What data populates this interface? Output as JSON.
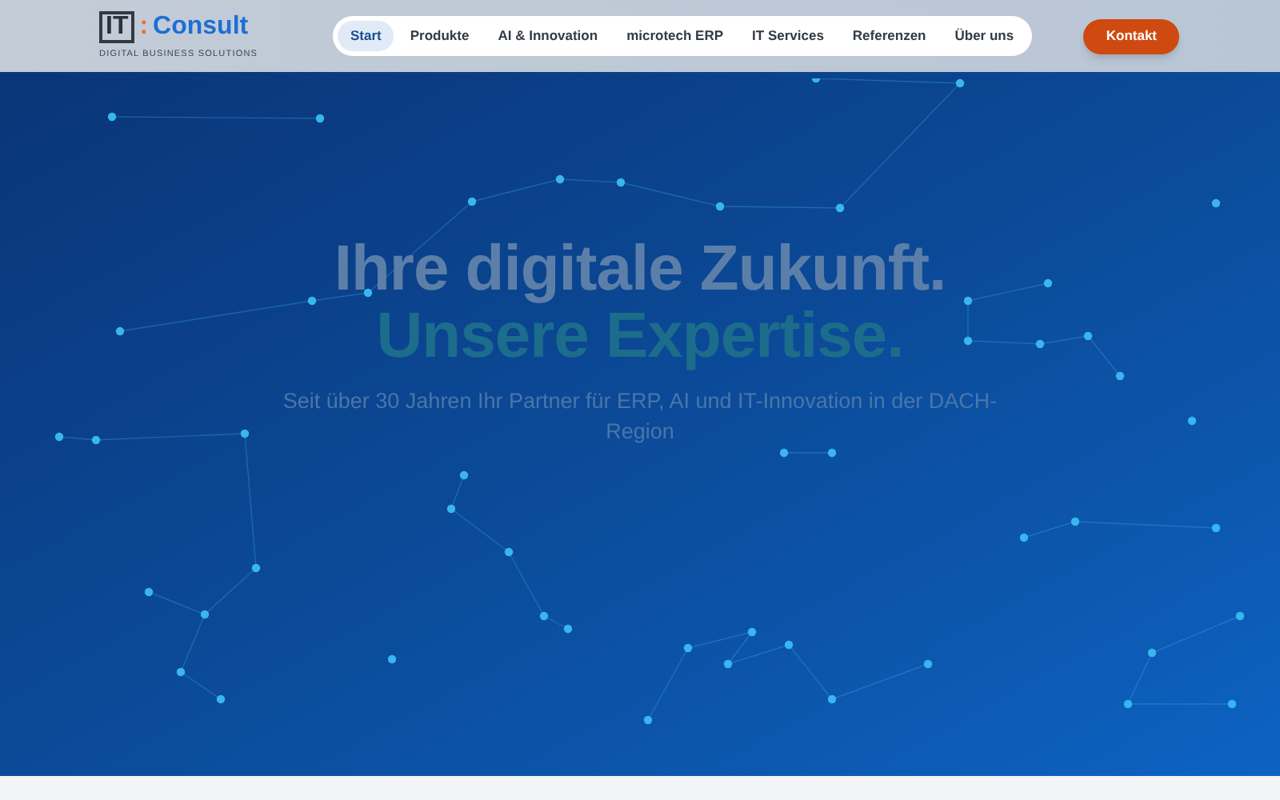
{
  "logo": {
    "mark": "IT",
    "separator": ":",
    "name": "Consult",
    "tagline": "DIGITAL BUSINESS SOLUTIONS"
  },
  "nav": [
    {
      "label": "Start",
      "selected": true
    },
    {
      "label": "Produkte",
      "selected": false
    },
    {
      "label": "AI & Innovation",
      "selected": false
    },
    {
      "label": "microtech ERP",
      "selected": false
    },
    {
      "label": "IT Services",
      "selected": false
    },
    {
      "label": "Referenzen",
      "selected": false
    },
    {
      "label": "Über uns",
      "selected": false
    }
  ],
  "cta": "Kontakt",
  "hero": {
    "headline": "Ihre digitale Zukunft.",
    "highlight": "Unsere Expertise.",
    "subtitle": "Seit über 30 Jahren Ihr Partner für ERP, AI und IT-Innovation in der DACH-Region"
  }
}
